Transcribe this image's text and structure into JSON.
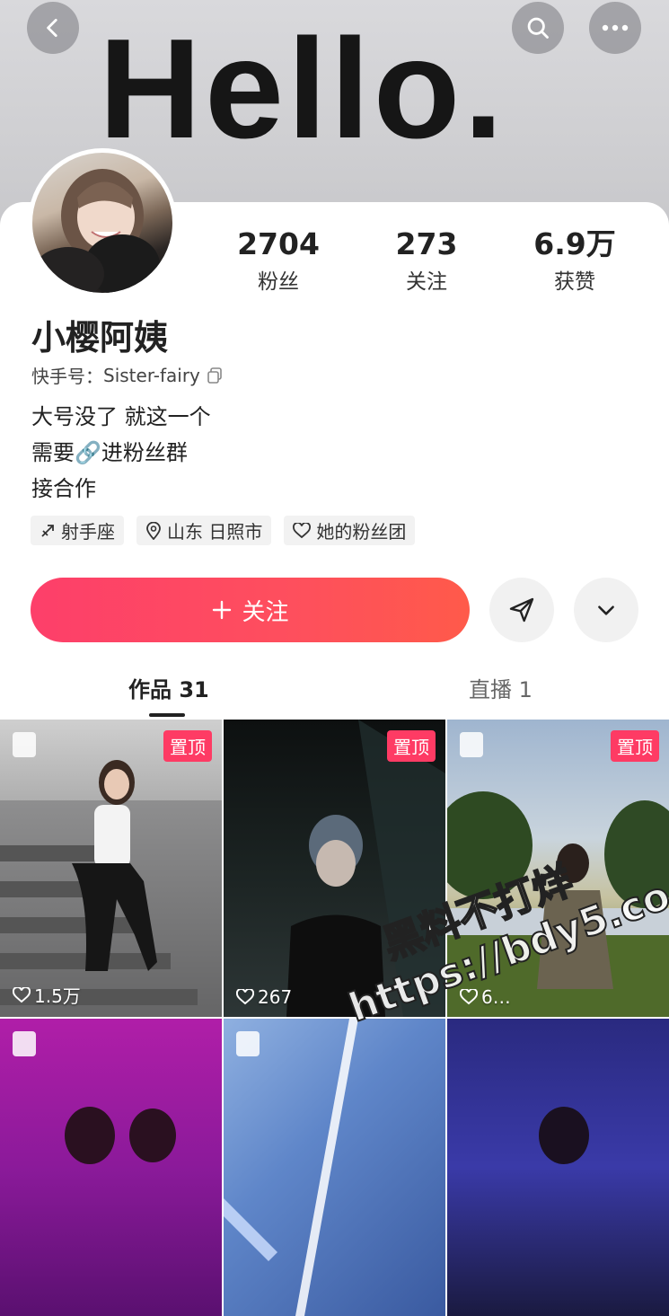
{
  "header": {
    "cover_text": "Hello."
  },
  "profile": {
    "name": "小樱阿姨",
    "uid_label": "快手号：",
    "uid": "Sister-fairy",
    "bio": [
      "大号没了 就这一个",
      "需要🔗进粉丝群",
      "接合作"
    ],
    "tags": [
      {
        "icon": "zodiac-icon",
        "label": "射手座"
      },
      {
        "icon": "location-pin-icon",
        "label": "山东 日照市"
      },
      {
        "icon": "fan-group-heart-icon",
        "label": "她的粉丝团"
      }
    ]
  },
  "stats": [
    {
      "num": "2704",
      "label": "粉丝"
    },
    {
      "num": "273",
      "label": "关注"
    },
    {
      "num": "6.9万",
      "label": "获赞"
    }
  ],
  "actions": {
    "follow_label": "关注"
  },
  "tabs": [
    {
      "label": "作品 31"
    },
    {
      "label": "直播 1"
    }
  ],
  "posts": [
    {
      "pinned": "置顶",
      "likes": "1.5万"
    },
    {
      "pinned": "置顶",
      "likes": "267"
    },
    {
      "pinned": "置顶",
      "likes": "6…"
    },
    {
      "pinned": "",
      "likes": ""
    },
    {
      "pinned": "",
      "likes": ""
    },
    {
      "pinned": "",
      "likes": ""
    }
  ],
  "watermark": {
    "line1": "黑料不打烊",
    "line2": "https://bdy5.co"
  },
  "colors": {
    "accent": "#fe3b64",
    "follow_gradient_start": "#fd3f6a",
    "follow_gradient_end": "#ff5a4a"
  }
}
